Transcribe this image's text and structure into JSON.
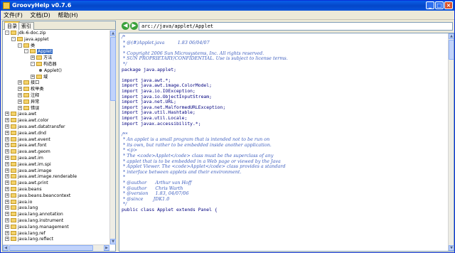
{
  "window": {
    "title": "GroovyHelp v0.7.6"
  },
  "window_controls": {
    "minimize": "_",
    "maximize": "□",
    "close": "×"
  },
  "menu": [
    "文件(F)",
    "文档(D)",
    "帮助(H)"
  ],
  "tabs": [
    "目录",
    "索引"
  ],
  "tree": [
    {
      "label": "jdk-6-doc.zip",
      "type": "folder",
      "expander": "-",
      "indent": 0
    },
    {
      "label": "java.applet",
      "type": "folder",
      "expander": "-",
      "indent": 1
    },
    {
      "label": "类",
      "type": "folder",
      "expander": "-",
      "indent": 2
    },
    {
      "label": "Applet",
      "type": "folder",
      "expander": "-",
      "indent": 3,
      "selected": true
    },
    {
      "label": "方法",
      "type": "folder",
      "expander": "+",
      "indent": 4
    },
    {
      "label": "构造器",
      "type": "folder",
      "expander": "-",
      "indent": 4
    },
    {
      "label": "Applet()",
      "type": "leaf",
      "expander": "",
      "indent": 5
    },
    {
      "label": "域",
      "type": "folder",
      "expander": "+",
      "indent": 4
    },
    {
      "label": "接口",
      "type": "folder",
      "expander": "+",
      "indent": 2
    },
    {
      "label": "枚举类",
      "type": "folder",
      "expander": "+",
      "indent": 2
    },
    {
      "label": "注释",
      "type": "folder",
      "expander": "+",
      "indent": 2
    },
    {
      "label": "异常",
      "type": "folder",
      "expander": "+",
      "indent": 2
    },
    {
      "label": "错误",
      "type": "folder",
      "expander": "+",
      "indent": 2
    },
    {
      "label": "java.awt",
      "type": "folder",
      "expander": "+",
      "indent": 0
    },
    {
      "label": "java.awt.color",
      "type": "folder",
      "expander": "+",
      "indent": 0
    },
    {
      "label": "java.awt.datatransfer",
      "type": "folder",
      "expander": "+",
      "indent": 0
    },
    {
      "label": "java.awt.dnd",
      "type": "folder",
      "expander": "+",
      "indent": 0
    },
    {
      "label": "java.awt.event",
      "type": "folder",
      "expander": "+",
      "indent": 0
    },
    {
      "label": "java.awt.font",
      "type": "folder",
      "expander": "+",
      "indent": 0
    },
    {
      "label": "java.awt.geom",
      "type": "folder",
      "expander": "+",
      "indent": 0
    },
    {
      "label": "java.awt.im",
      "type": "folder",
      "expander": "+",
      "indent": 0
    },
    {
      "label": "java.awt.im.spi",
      "type": "folder",
      "expander": "+",
      "indent": 0
    },
    {
      "label": "java.awt.image",
      "type": "folder",
      "expander": "+",
      "indent": 0
    },
    {
      "label": "java.awt.image.renderable",
      "type": "folder",
      "expander": "+",
      "indent": 0
    },
    {
      "label": "java.awt.print",
      "type": "folder",
      "expander": "+",
      "indent": 0
    },
    {
      "label": "java.beans",
      "type": "folder",
      "expander": "+",
      "indent": 0
    },
    {
      "label": "java.beans.beancontext",
      "type": "folder",
      "expander": "+",
      "indent": 0
    },
    {
      "label": "java.io",
      "type": "folder",
      "expander": "+",
      "indent": 0
    },
    {
      "label": "java.lang",
      "type": "folder",
      "expander": "+",
      "indent": 0
    },
    {
      "label": "java.lang.annotation",
      "type": "folder",
      "expander": "+",
      "indent": 0
    },
    {
      "label": "java.lang.instrument",
      "type": "folder",
      "expander": "+",
      "indent": 0
    },
    {
      "label": "java.lang.management",
      "type": "folder",
      "expander": "+",
      "indent": 0
    },
    {
      "label": "java.lang.ref",
      "type": "folder",
      "expander": "+",
      "indent": 0
    },
    {
      "label": "java.lang.reflect",
      "type": "folder",
      "expander": "+",
      "indent": 0
    }
  ],
  "nav": {
    "back_icon": "arrow-left-icon",
    "forward_icon": "arrow-right-icon",
    "address": "arc://java/applet/Applet"
  },
  "code_lines": [
    {
      "t": "/*",
      "c": "cmt"
    },
    {
      "t": " * @(#)Applet.java         1.83 06/04/07",
      "c": "cmt"
    },
    {
      "t": " *",
      "c": "cmt"
    },
    {
      "t": " * Copyright 2006 Sun Microsystems, Inc. All rights reserved.",
      "c": "cmt"
    },
    {
      "t": " * SUN PROPRIETARY/CONFIDENTIAL. Use is subject to license terms.",
      "c": "cmt"
    },
    {
      "t": " */",
      "c": "cmt"
    },
    {
      "t": "package java.applet;",
      "c": "kw"
    },
    {
      "t": "",
      "c": "plain"
    },
    {
      "t": "import java.awt.*;",
      "c": "kw"
    },
    {
      "t": "import java.awt.image.ColorModel;",
      "c": "kw"
    },
    {
      "t": "import java.io.IOException;",
      "c": "kw"
    },
    {
      "t": "import java.io.ObjectInputStream;",
      "c": "kw"
    },
    {
      "t": "import java.net.URL;",
      "c": "kw"
    },
    {
      "t": "import java.net.MalformedURLException;",
      "c": "kw"
    },
    {
      "t": "import java.util.Hashtable;",
      "c": "kw"
    },
    {
      "t": "import java.util.Locale;",
      "c": "kw"
    },
    {
      "t": "import javax.accessibility.*;",
      "c": "kw"
    },
    {
      "t": "",
      "c": "plain"
    },
    {
      "t": "/**",
      "c": "cmt"
    },
    {
      "t": " * An applet is a small program that is intended not to be run on",
      "c": "cmt"
    },
    {
      "t": " * its own, but rather to be embedded inside another application.",
      "c": "cmt"
    },
    {
      "t": " * <p>",
      "c": "cmt"
    },
    {
      "t": " * The <code>Applet</code> class must be the superclass of any",
      "c": "cmt"
    },
    {
      "t": " * applet that is to be embedded in a Web page or viewed by the Java",
      "c": "cmt"
    },
    {
      "t": " * Applet Viewer. The <code>Applet</code> class provides a standard",
      "c": "cmt"
    },
    {
      "t": " * interface between applets and their environment.",
      "c": "cmt"
    },
    {
      "t": " *",
      "c": "cmt"
    },
    {
      "t": " * @author      Arthur van Hoff",
      "c": "cmt"
    },
    {
      "t": " * @author      Chris Warth",
      "c": "cmt"
    },
    {
      "t": " * @version     1.83, 04/07/06",
      "c": "cmt"
    },
    {
      "t": " * @since       JDK1.0",
      "c": "cmt"
    },
    {
      "t": " */",
      "c": "cmt"
    },
    {
      "t": "public class Applet extends Panel {",
      "c": "kw"
    }
  ]
}
